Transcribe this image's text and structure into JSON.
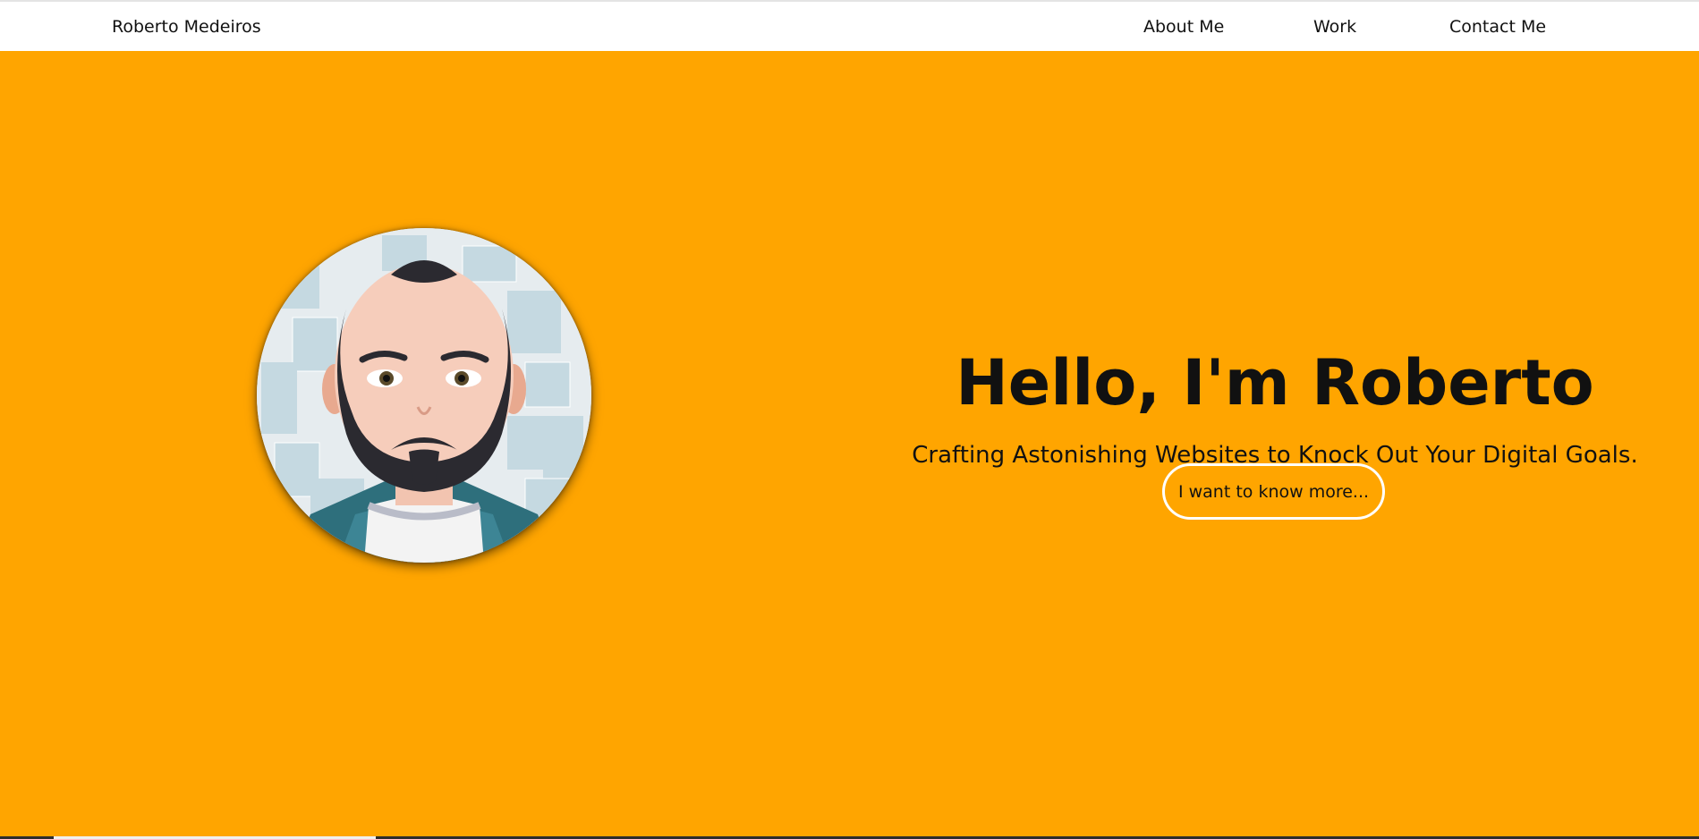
{
  "nav": {
    "brand": "Roberto Medeiros",
    "links": [
      "About Me",
      "Work",
      "Contact Me"
    ]
  },
  "hero": {
    "title": "Hello, I'm Roberto",
    "subtitle": "Crafting Astonishing Websites to Knock Out Your Digital Goals.",
    "cta_label": "I want to know more..."
  },
  "colors": {
    "background": "#ffa500",
    "navbar": "#ffffff",
    "text": "#111111",
    "button_border": "#ffffff"
  },
  "icons": {
    "avatar": "cartoon-portrait-avatar"
  }
}
